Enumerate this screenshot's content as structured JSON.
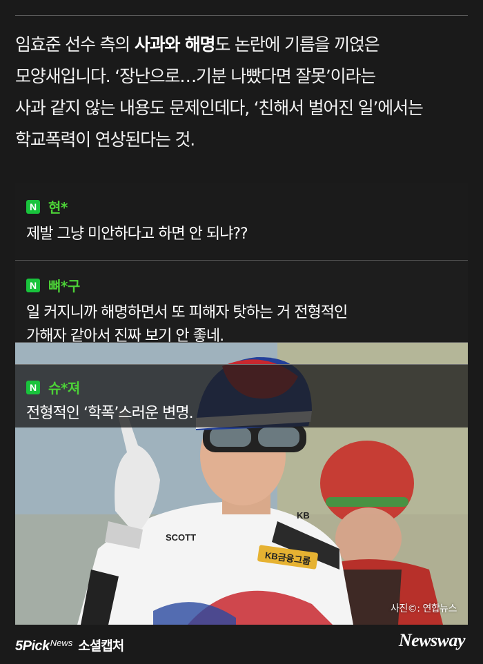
{
  "intro": {
    "l1a": "임효준 선수 측의 ",
    "l1b": "사과와 해명",
    "l1c": "도 논란에 기름을 끼얹은",
    "l2": "모양새입니다. ‘장난으로…기분 나빴다면 잘못’이라는",
    "l3": "사과 같지 않는 내용도 문제인데다, ‘친해서 벌어진 일’에서는",
    "l4": "학교폭력이 연상된다는 것."
  },
  "comments": [
    {
      "badge": "N",
      "user": "현*",
      "lines": [
        "제발 그냥 미안하다고 하면 안 되냐??"
      ]
    },
    {
      "badge": "N",
      "user": "뼈*구",
      "lines": [
        "일 커지니까 해명하면서 또 피해자 탓하는 거 전형적인",
        "가해자 같아서 진짜 보기 안 좋네."
      ]
    },
    {
      "badge": "N",
      "user": "슈*져",
      "lines": [
        "전형적인 ‘학폭’스러운 변명."
      ]
    }
  ],
  "photo": {
    "credit": "사진©: 연합뉴스",
    "jersey_text": "SCOTT",
    "sponsor_text": "KB금융그룹",
    "kb_text": "KB"
  },
  "footer": {
    "brand_5pick": "5Pick",
    "brand_news": "News",
    "brand_caption": "소셜캡처",
    "publisher": "Newsway"
  },
  "colors": {
    "background": "#1a1a1a",
    "naver_green": "#19c33c",
    "username_green": "#4cd137"
  }
}
